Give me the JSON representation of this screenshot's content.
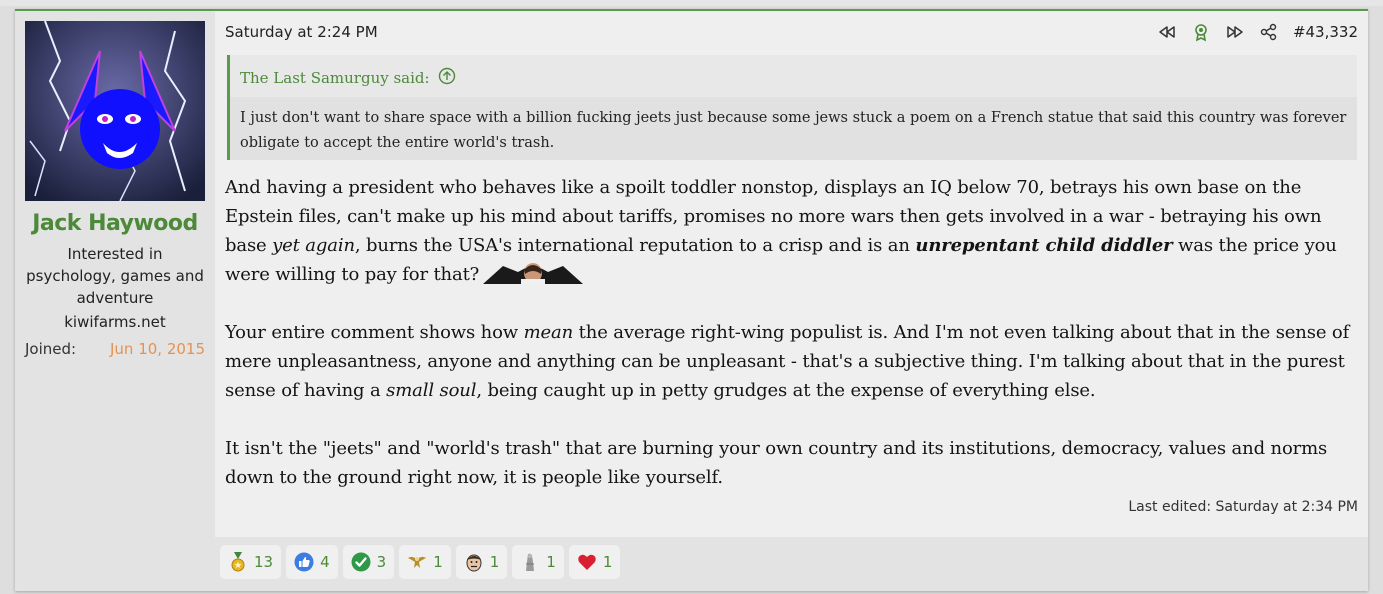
{
  "user": {
    "name": "Jack Haywood",
    "title": "Interested in psychology, games and adventure",
    "site": "kiwifarms.net",
    "joined_label": "Joined:",
    "joined_date": "Jun 10, 2015"
  },
  "post": {
    "date": "Saturday at 2:24 PM",
    "number": "#43,332",
    "last_edited": "Last edited: Saturday at 2:34 PM"
  },
  "quote": {
    "author_said": "The Last Samurguy said:",
    "text": "I just don't want to share space with a billion fucking jeets just because some jews stuck a poem on a French statue that said this country was forever obligate to accept the entire world's trash."
  },
  "body": {
    "p1_a": "And having a president who behaves like a spoilt toddler nonstop, displays an IQ below 70, betrays his own base on the Epstein files, can't make up his mind about tariffs, promises no more wars then gets involved in a war - betraying his own base ",
    "p1_em1": "yet again",
    "p1_b": ", burns the USA's international reputation to a crisp and is an ",
    "p1_strong": "unrepentant child diddler",
    "p1_c": " was the price you were willing to pay for that?",
    "p2_a": "Your entire comment shows how ",
    "p2_em1": "mean",
    "p2_b": " the average right-wing populist is. And I'm not even talking about that in the sense of mere unpleasantness, anyone and anything can be unpleasant - that's a subjective thing. I'm talking about that in the purest sense of having a ",
    "p2_em2": "small soul",
    "p2_c": ", being caught up in petty grudges at the expense of everything else.",
    "p3": "It isn't the \"jeets\" and \"world's trash\" that are burning your own country and its institutions, democracy, values and norms down to the ground right now, it is people like yourself."
  },
  "reactions": [
    {
      "icon": "medal-icon",
      "count": "13"
    },
    {
      "icon": "thumbs-up-icon",
      "count": "4"
    },
    {
      "icon": "checkmark-icon",
      "count": "3"
    },
    {
      "icon": "eagle-icon",
      "count": "1"
    },
    {
      "icon": "face-icon",
      "count": "1"
    },
    {
      "icon": "statue-icon",
      "count": "1"
    },
    {
      "icon": "heart-icon",
      "count": "1"
    }
  ],
  "colors": {
    "accent": "#4c8a3a",
    "joined_date": "#e8914f",
    "avatar_blue": "#1a1aff"
  }
}
